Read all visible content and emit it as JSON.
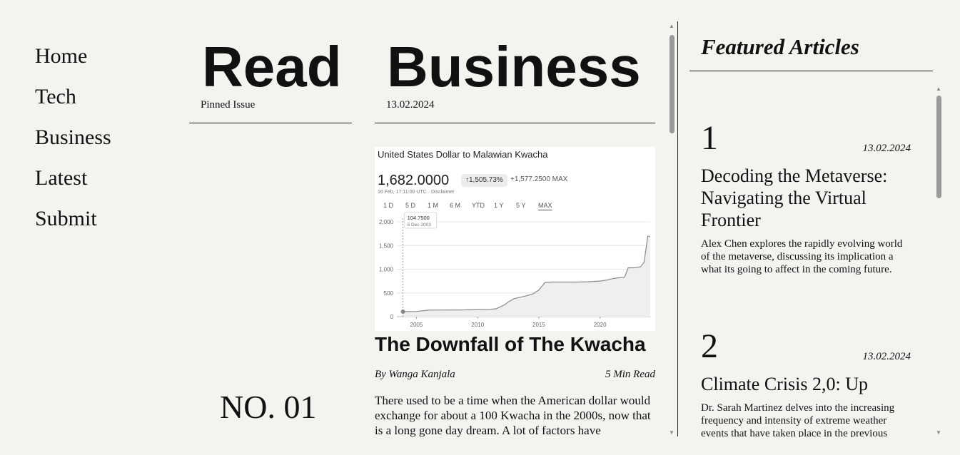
{
  "nav": {
    "items": [
      "Home",
      "Tech",
      "Business",
      "Latest",
      "Submit"
    ]
  },
  "pinned": {
    "title": "Read",
    "label": "Pinned Issue",
    "issue_number": "NO. 01"
  },
  "main": {
    "section_title": "Business",
    "date": "13.02.2024",
    "chart_card": {
      "title": "United States Dollar to Malawian Kwacha",
      "value": "1,682.0000",
      "change_pill": "↑1,505.73%",
      "change_abs": "+1,577.2500 MAX",
      "timestamp": "16 Feb, 17:11:00 UTC · Disclaimer",
      "ranges": [
        "1 D",
        "5 D",
        "1 M",
        "6 M",
        "YTD",
        "1 Y",
        "5 Y",
        "MAX"
      ],
      "active_range": "MAX",
      "tooltip_value": "104.7500",
      "tooltip_date": "5 Dec 2003"
    },
    "article": {
      "title": "The Downfall of The Kwacha",
      "byline": "By Wanga Kanjala",
      "read_time": "5 Min Read",
      "body": "There used to be a time when the American dollar would exchange for about a 100 Kwacha in the 2000s, now that is a long gone day dream. A lot of factors have contributed to this steady decline over the years."
    }
  },
  "featured": {
    "title": "Featured Articles",
    "items": [
      {
        "number": "1",
        "date": "13.02.2024",
        "title": "Decoding the Metaverse: Navigating the Virtual Frontier",
        "desc": "Alex Chen explores the rapidly evolving world of the metaverse, discussing its implication a what its going to affect in the coming future."
      },
      {
        "number": "2",
        "date": "13.02.2024",
        "title": "Climate Crisis 2,0: Up",
        "desc": "Dr. Sarah Martinez delves into the increasing frequency and intensity of extreme weather events that have taken place in the previous years."
      }
    ]
  },
  "colors": {
    "background": "#f3f3ef",
    "text": "#111111",
    "chart_line": "#8a8a8a"
  },
  "chart_data": {
    "type": "line",
    "title": "United States Dollar to Malawian Kwacha",
    "x_ticks": [
      "2005",
      "2010",
      "2015",
      "2020"
    ],
    "y_ticks": [
      0,
      500,
      1000,
      1500,
      2000
    ],
    "ylim": [
      0,
      2000
    ],
    "xlim": [
      2003.4,
      2024.1
    ],
    "grid": true,
    "series": [
      {
        "x": [
          2003.9,
          2005.0,
          2006.0,
          2007.0,
          2008.0,
          2009.0,
          2010.0,
          2011.0,
          2011.5,
          2012.2,
          2012.5,
          2013.0,
          2013.5,
          2014.0,
          2014.5,
          2015.0,
          2015.5,
          2016.0,
          2017.0,
          2018.0,
          2019.0,
          2020.0,
          2020.5,
          2021.0,
          2021.5,
          2022.0,
          2022.3,
          2022.8,
          2023.3,
          2023.6,
          2023.9,
          2024.1
        ],
        "y": [
          104.75,
          110,
          137,
          140,
          141,
          143,
          150,
          155,
          165,
          250,
          310,
          380,
          410,
          440,
          480,
          560,
          720,
          730,
          730,
          730,
          735,
          750,
          770,
          800,
          820,
          830,
          1030,
          1030,
          1050,
          1150,
          1700,
          1682
        ]
      }
    ]
  }
}
